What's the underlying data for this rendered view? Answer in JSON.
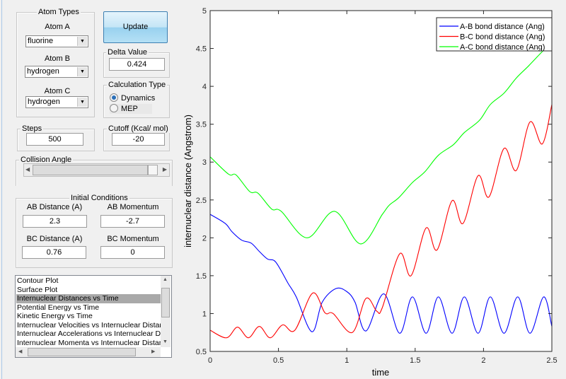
{
  "atom_types": {
    "title": "Atom Types",
    "atom_a": {
      "label": "Atom A",
      "value": "fluorine"
    },
    "atom_b": {
      "label": "Atom B",
      "value": "hydrogen"
    },
    "atom_c": {
      "label": "Atom C",
      "value": "hydrogen"
    }
  },
  "update_button": "Update",
  "delta": {
    "title": "Delta Value",
    "value": "0.424"
  },
  "calc_type": {
    "title": "Calculation Type",
    "options": [
      "Dynamics",
      "MEP"
    ],
    "selected": "Dynamics"
  },
  "steps": {
    "title": "Steps",
    "value": "500"
  },
  "cutoff": {
    "title": "Cutoff (Kcal/ mol)",
    "value": "-20"
  },
  "collision_angle": {
    "title": "Collision Angle",
    "slider_fraction": 0.92
  },
  "initial_conditions": {
    "title": "Initial Conditions",
    "ab_distance": {
      "label": "AB Distance (A)",
      "value": "2.3"
    },
    "ab_momentum": {
      "label": "AB Momentum",
      "value": "-2.7"
    },
    "bc_distance": {
      "label": "BC Distance (A)",
      "value": "0.76"
    },
    "bc_momentum": {
      "label": "BC Momentum",
      "value": "0"
    }
  },
  "plot_list": {
    "items": [
      "Contour Plot",
      "Surface Plot",
      "Internuclear Distances vs Time",
      "Potential Energy vs Time",
      "Kinetic Energy vs Time",
      "Internuclear Velocities vs Internuclear Distance",
      "Internuclear Accelerations vs Internuclear Distance",
      "Internuclear Momenta vs Internuclear Distance"
    ],
    "selected_index": 2
  },
  "chart_data": {
    "type": "line",
    "xlabel": "time",
    "ylabel": "internuclear distance (Angstrom)",
    "xlim": [
      0,
      2.5
    ],
    "ylim": [
      0.5,
      5
    ],
    "xticks": [
      "0",
      "0.5",
      "1",
      "1.5",
      "2",
      "2.5"
    ],
    "yticks": [
      "0.5",
      "1",
      "1.5",
      "2",
      "2.5",
      "3",
      "3.5",
      "4",
      "4.5",
      "5"
    ],
    "legend": "top-right",
    "series": [
      {
        "name": "A-B bond distance (Ang)",
        "color": "#0000ff",
        "points": [
          [
            0,
            2.31
          ],
          [
            0.11,
            2.19
          ],
          [
            0.16,
            2.08
          ],
          [
            0.23,
            1.97
          ],
          [
            0.3,
            1.93
          ],
          [
            0.36,
            1.82
          ],
          [
            0.42,
            1.72
          ],
          [
            0.48,
            1.68
          ],
          [
            0.57,
            1.4
          ],
          [
            0.63,
            1.22
          ],
          [
            0.745,
            0.76
          ],
          [
            0.82,
            1.15
          ],
          [
            0.92,
            1.33
          ],
          [
            1.0,
            1.29
          ],
          [
            1.06,
            1.15
          ],
          [
            1.14,
            0.77
          ],
          [
            1.27,
            1.26
          ],
          [
            1.387,
            0.74
          ],
          [
            1.48,
            1.22
          ],
          [
            1.58,
            0.74
          ],
          [
            1.67,
            1.22
          ],
          [
            1.77,
            0.74
          ],
          [
            1.86,
            1.22
          ],
          [
            1.96,
            0.74
          ],
          [
            2.05,
            1.22
          ],
          [
            2.15,
            0.74
          ],
          [
            2.25,
            1.22
          ],
          [
            2.34,
            0.74
          ],
          [
            2.44,
            1.22
          ],
          [
            2.5,
            0.83
          ]
        ]
      },
      {
        "name": "B-C bond distance (Ang)",
        "color": "#ff0000",
        "points": [
          [
            0,
            0.78
          ],
          [
            0.12,
            0.68
          ],
          [
            0.2,
            0.82
          ],
          [
            0.28,
            0.68
          ],
          [
            0.36,
            0.83
          ],
          [
            0.44,
            0.68
          ],
          [
            0.53,
            0.85
          ],
          [
            0.62,
            0.78
          ],
          [
            0.75,
            1.27
          ],
          [
            0.84,
            1.01
          ],
          [
            0.9,
            1.0
          ],
          [
            1.04,
            0.75
          ],
          [
            1.14,
            1.2
          ],
          [
            1.22,
            1.03
          ],
          [
            1.26,
            1.08
          ],
          [
            1.387,
            1.79
          ],
          [
            1.47,
            1.5
          ],
          [
            1.58,
            2.13
          ],
          [
            1.66,
            1.84
          ],
          [
            1.77,
            2.49
          ],
          [
            1.85,
            2.19
          ],
          [
            1.96,
            2.82
          ],
          [
            2.04,
            2.54
          ],
          [
            2.15,
            3.18
          ],
          [
            2.24,
            2.89
          ],
          [
            2.34,
            3.53
          ],
          [
            2.43,
            3.24
          ],
          [
            2.5,
            3.76
          ]
        ]
      },
      {
        "name": "A-C bond distance (Ang)",
        "color": "#00ff00",
        "points": [
          [
            0,
            3.07
          ],
          [
            0.135,
            2.84
          ],
          [
            0.19,
            2.83
          ],
          [
            0.29,
            2.61
          ],
          [
            0.35,
            2.59
          ],
          [
            0.45,
            2.38
          ],
          [
            0.52,
            2.35
          ],
          [
            0.71,
            2.0
          ],
          [
            0.91,
            2.35
          ],
          [
            1.1,
            1.92
          ],
          [
            1.26,
            2.31
          ],
          [
            1.31,
            2.43
          ],
          [
            1.38,
            2.53
          ],
          [
            1.48,
            2.73
          ],
          [
            1.57,
            2.87
          ],
          [
            1.67,
            3.09
          ],
          [
            1.78,
            3.23
          ],
          [
            1.86,
            3.39
          ],
          [
            1.97,
            3.55
          ],
          [
            2.05,
            3.76
          ],
          [
            2.15,
            3.91
          ],
          [
            2.24,
            4.11
          ],
          [
            2.33,
            4.27
          ],
          [
            2.43,
            4.46
          ],
          [
            2.5,
            4.59
          ]
        ]
      }
    ]
  }
}
